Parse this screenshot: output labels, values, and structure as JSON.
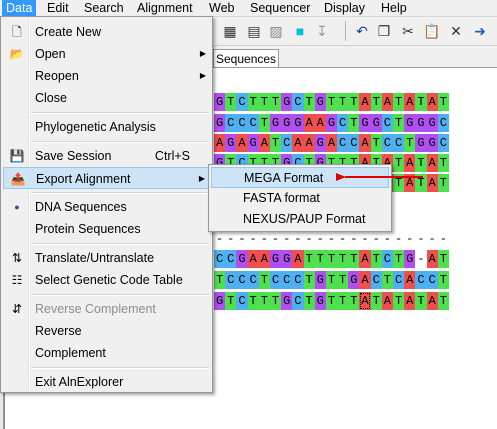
{
  "menubar": [
    "Data",
    "Edit",
    "Search",
    "Alignment",
    "Web",
    "Sequencer",
    "Display",
    "Help"
  ],
  "tab": "Sequences",
  "data_menu": {
    "items": [
      {
        "label": "Create New",
        "icon": "new-file-icon",
        "submenu": false,
        "disabled": false
      },
      {
        "label": "Open",
        "icon": "open-folder-icon",
        "submenu": true,
        "disabled": false
      },
      {
        "label": "Reopen",
        "icon": "",
        "submenu": true,
        "disabled": false
      },
      {
        "label": "Close",
        "icon": "",
        "submenu": false,
        "disabled": false
      },
      {
        "sep": true
      },
      {
        "label": "Phylogenetic Analysis",
        "icon": "",
        "submenu": false,
        "disabled": false
      },
      {
        "sep": true
      },
      {
        "label": "Save Session",
        "icon": "save-disk-icon",
        "shortcut": "Ctrl+S",
        "submenu": false,
        "disabled": false
      },
      {
        "label": "Export Alignment",
        "icon": "export-icon",
        "submenu": true,
        "disabled": false,
        "highlight": true
      },
      {
        "sep": true
      },
      {
        "label": "DNA Sequences",
        "icon": "radio-dot-icon",
        "submenu": false,
        "disabled": false
      },
      {
        "label": "Protein Sequences",
        "icon": "",
        "submenu": false,
        "disabled": false
      },
      {
        "sep": true
      },
      {
        "label": "Translate/Untranslate",
        "icon": "translate-icon",
        "submenu": false,
        "disabled": false
      },
      {
        "label": "Select Genetic Code Table",
        "icon": "genetic-code-icon",
        "submenu": false,
        "disabled": false
      },
      {
        "sep": true
      },
      {
        "label": "Reverse Complement",
        "icon": "reverse-complement-icon",
        "submenu": false,
        "disabled": true
      },
      {
        "label": "Reverse",
        "icon": "",
        "submenu": false,
        "disabled": false
      },
      {
        "label": "Complement",
        "icon": "",
        "submenu": false,
        "disabled": false
      },
      {
        "sep": true
      },
      {
        "label": "Exit AlnExplorer",
        "icon": "",
        "submenu": false,
        "disabled": false
      }
    ]
  },
  "export_submenu": [
    "MEGA Format",
    "FASTA format",
    "NEXUS/PAUP Format"
  ],
  "colors": {
    "A": "#ef4f4f",
    "C": "#4fb0ef",
    "G": "#b04fef",
    "T": "#4fe04f",
    "accent": "#cde4f7",
    "arrow": "#e00000"
  },
  "sequences": [
    "GTCTTTGCTGTTTATATATAT",
    "GCCCTGGGAAGCTGGCTGGGC",
    "AGAGATCAAGACCATCCTGGC",
    "GTCTTTGCTGTTTATATATAT",
    "GTCTTTGCTGTTTATATATAT",
    "CCGAAGGATTTTTATCTG-AT",
    "TCCCTCCCTGTTGACTCACCT",
    "GTCTTTGCTGTTTATATATAT"
  ],
  "partial_sequences": [
    {
      "row": 4,
      "text": "CTGGAAC-"
    },
    {
      "row": 5,
      "text": "-"
    }
  ]
}
